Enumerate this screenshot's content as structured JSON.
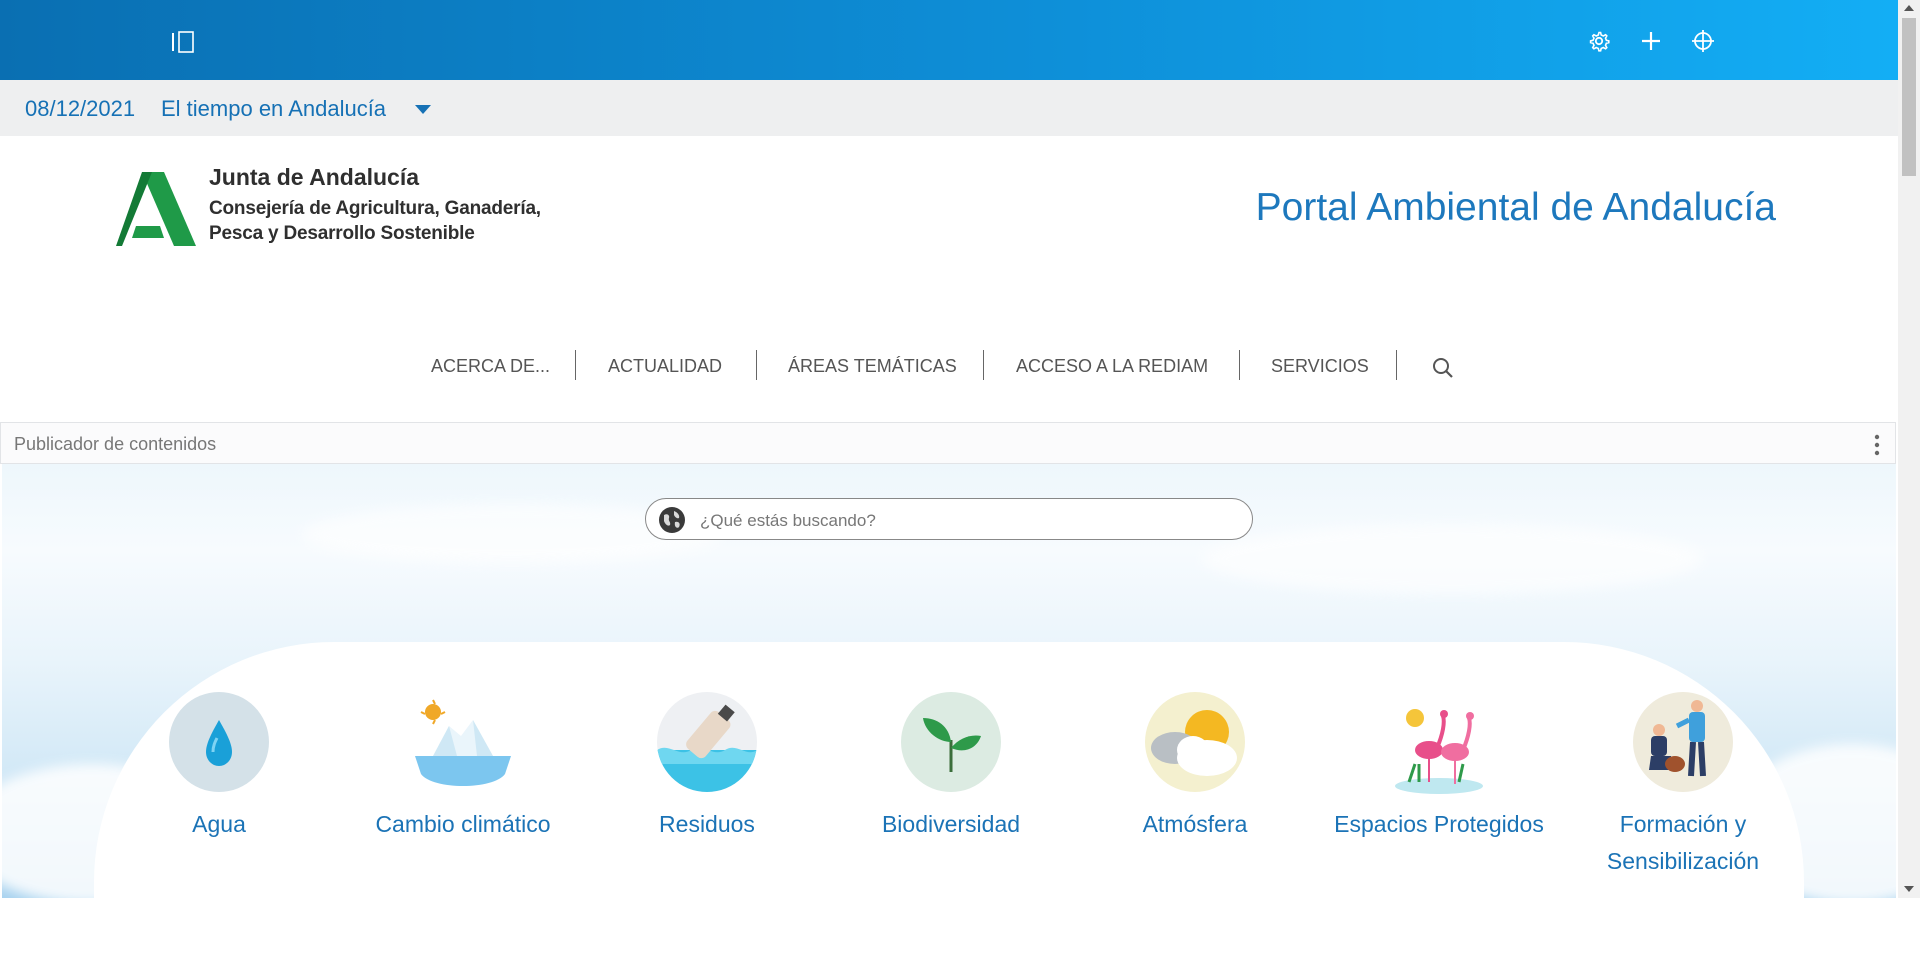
{
  "topbar": {
    "icons": [
      "panel-toggle-icon",
      "gear-icon",
      "plus-icon",
      "target-icon"
    ]
  },
  "weather": {
    "date": "08/12/2021",
    "title": "El tiempo en Andalucía"
  },
  "header": {
    "logo_title": "Junta de Andalucía",
    "logo_sub_line1": "Consejería de Agricultura, Ganadería,",
    "logo_sub_line2": "Pesca y Desarrollo Sostenible",
    "portal_title": "Portal Ambiental de Andalucía"
  },
  "nav": {
    "items": [
      "ACERCA DE...",
      "ACTUALIDAD",
      "ÁREAS TEMÁTICAS",
      "ACCESO A LA REDIAM",
      "SERVICIOS"
    ]
  },
  "publisher": {
    "label": "Publicador de contenidos"
  },
  "search": {
    "placeholder": "¿Qué estás buscando?"
  },
  "categories": [
    {
      "name": "Agua",
      "icon": "water-drop-icon"
    },
    {
      "name": "Cambio climático",
      "icon": "melting-iceberg-icon"
    },
    {
      "name": "Residuos",
      "icon": "bottle-in-sea-icon"
    },
    {
      "name": "Biodiversidad",
      "icon": "sprout-icon"
    },
    {
      "name": "Atmósfera",
      "icon": "sun-cloud-icon"
    },
    {
      "name": "Espacios Protegidos",
      "icon": "flamingos-icon"
    },
    {
      "name": "Formación y Sensibilización",
      "icon": "people-teaching-icon"
    }
  ],
  "colors": {
    "accent": "#1671b5",
    "topbar_start": "#0a6fb2",
    "topbar_end": "#13aef5",
    "logo_green": "#1f9a48"
  }
}
